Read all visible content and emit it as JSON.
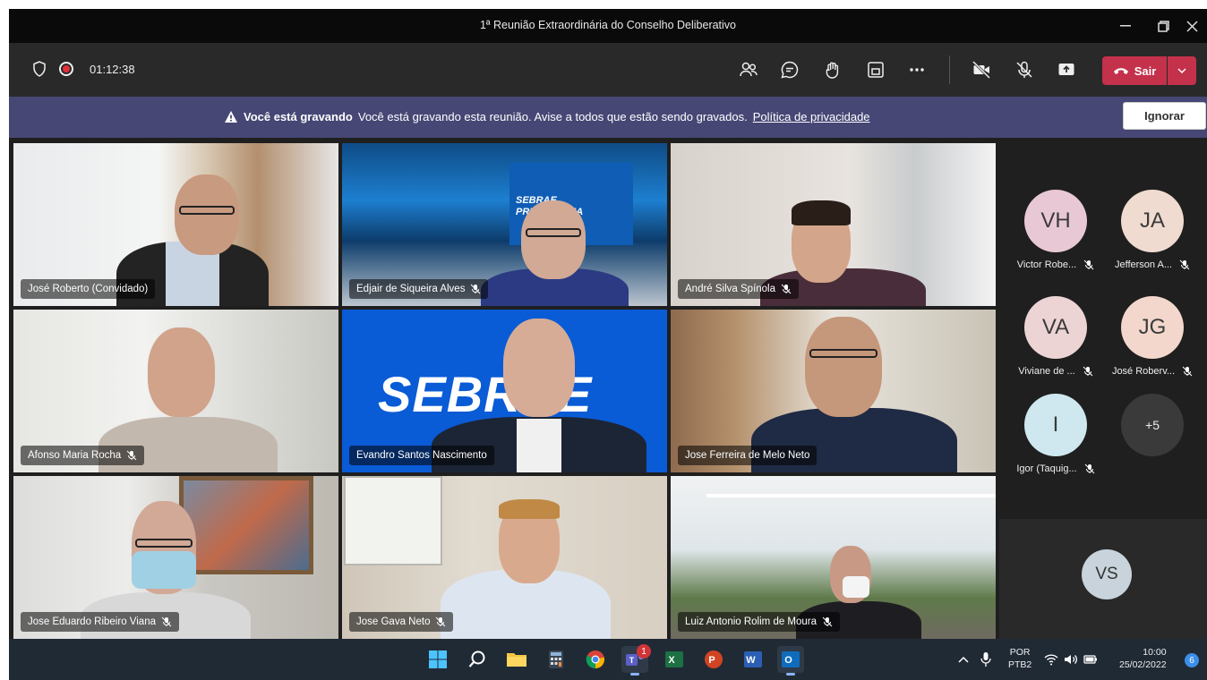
{
  "window": {
    "title": "1ª Reunião Extraordinária do Conselho Deliberativo"
  },
  "toolbar": {
    "timer": "01:12:38",
    "leave_label": "Sair"
  },
  "banner": {
    "bold": "Você está gravando",
    "message": "Você está gravando esta reunião. Avise a todos que estão sendo gravados.",
    "link": "Política de privacidade",
    "dismiss": "Ignorar"
  },
  "tiles": [
    {
      "name": "José Roberto (Convidado)",
      "muted": false
    },
    {
      "name": "Edjair de Siqueira Alves",
      "muted": true,
      "backdrop_text": [
        "SEBRAE",
        "PREVIDÊNCIA"
      ]
    },
    {
      "name": "André Silva Spínola",
      "muted": true
    },
    {
      "name": "Afonso Maria Rocha",
      "muted": true
    },
    {
      "name": "Evandro Santos Nascimento",
      "muted": false,
      "backdrop_text": [
        "SEBRAE"
      ]
    },
    {
      "name": "Jose Ferreira de Melo Neto",
      "muted": false
    },
    {
      "name": "Jose Eduardo Ribeiro Viana",
      "muted": true
    },
    {
      "name": "Jose Gava Neto",
      "muted": true
    },
    {
      "name": "Luiz Antonio Rolim de Moura",
      "muted": true
    }
  ],
  "panel": {
    "participants": [
      {
        "initials": "VH",
        "name": "Victor Robe...",
        "color": "#e9c8d6"
      },
      {
        "initials": "JA",
        "name": "Jefferson A...",
        "color": "#f0dbd0"
      },
      {
        "initials": "VA",
        "name": "Viviane de ...",
        "color": "#edd4d4"
      },
      {
        "initials": "JG",
        "name": "José Roberv...",
        "color": "#f3d7cd"
      },
      {
        "initials": "I",
        "name": "Igor (Taquig...",
        "color": "#cfe8ef"
      }
    ],
    "overflow": "+5",
    "self_initials": "VS"
  },
  "taskbar": {
    "teams_badge": "1",
    "language": "POR",
    "layout": "PTB2",
    "time": "10:00",
    "date": "25/02/2022",
    "notif_count": "6"
  },
  "colors": {
    "banner": "#464775",
    "leave": "#c4314b",
    "teams_purple": "#5b5fc7",
    "sebrae_blue": "#0a5bd6"
  }
}
